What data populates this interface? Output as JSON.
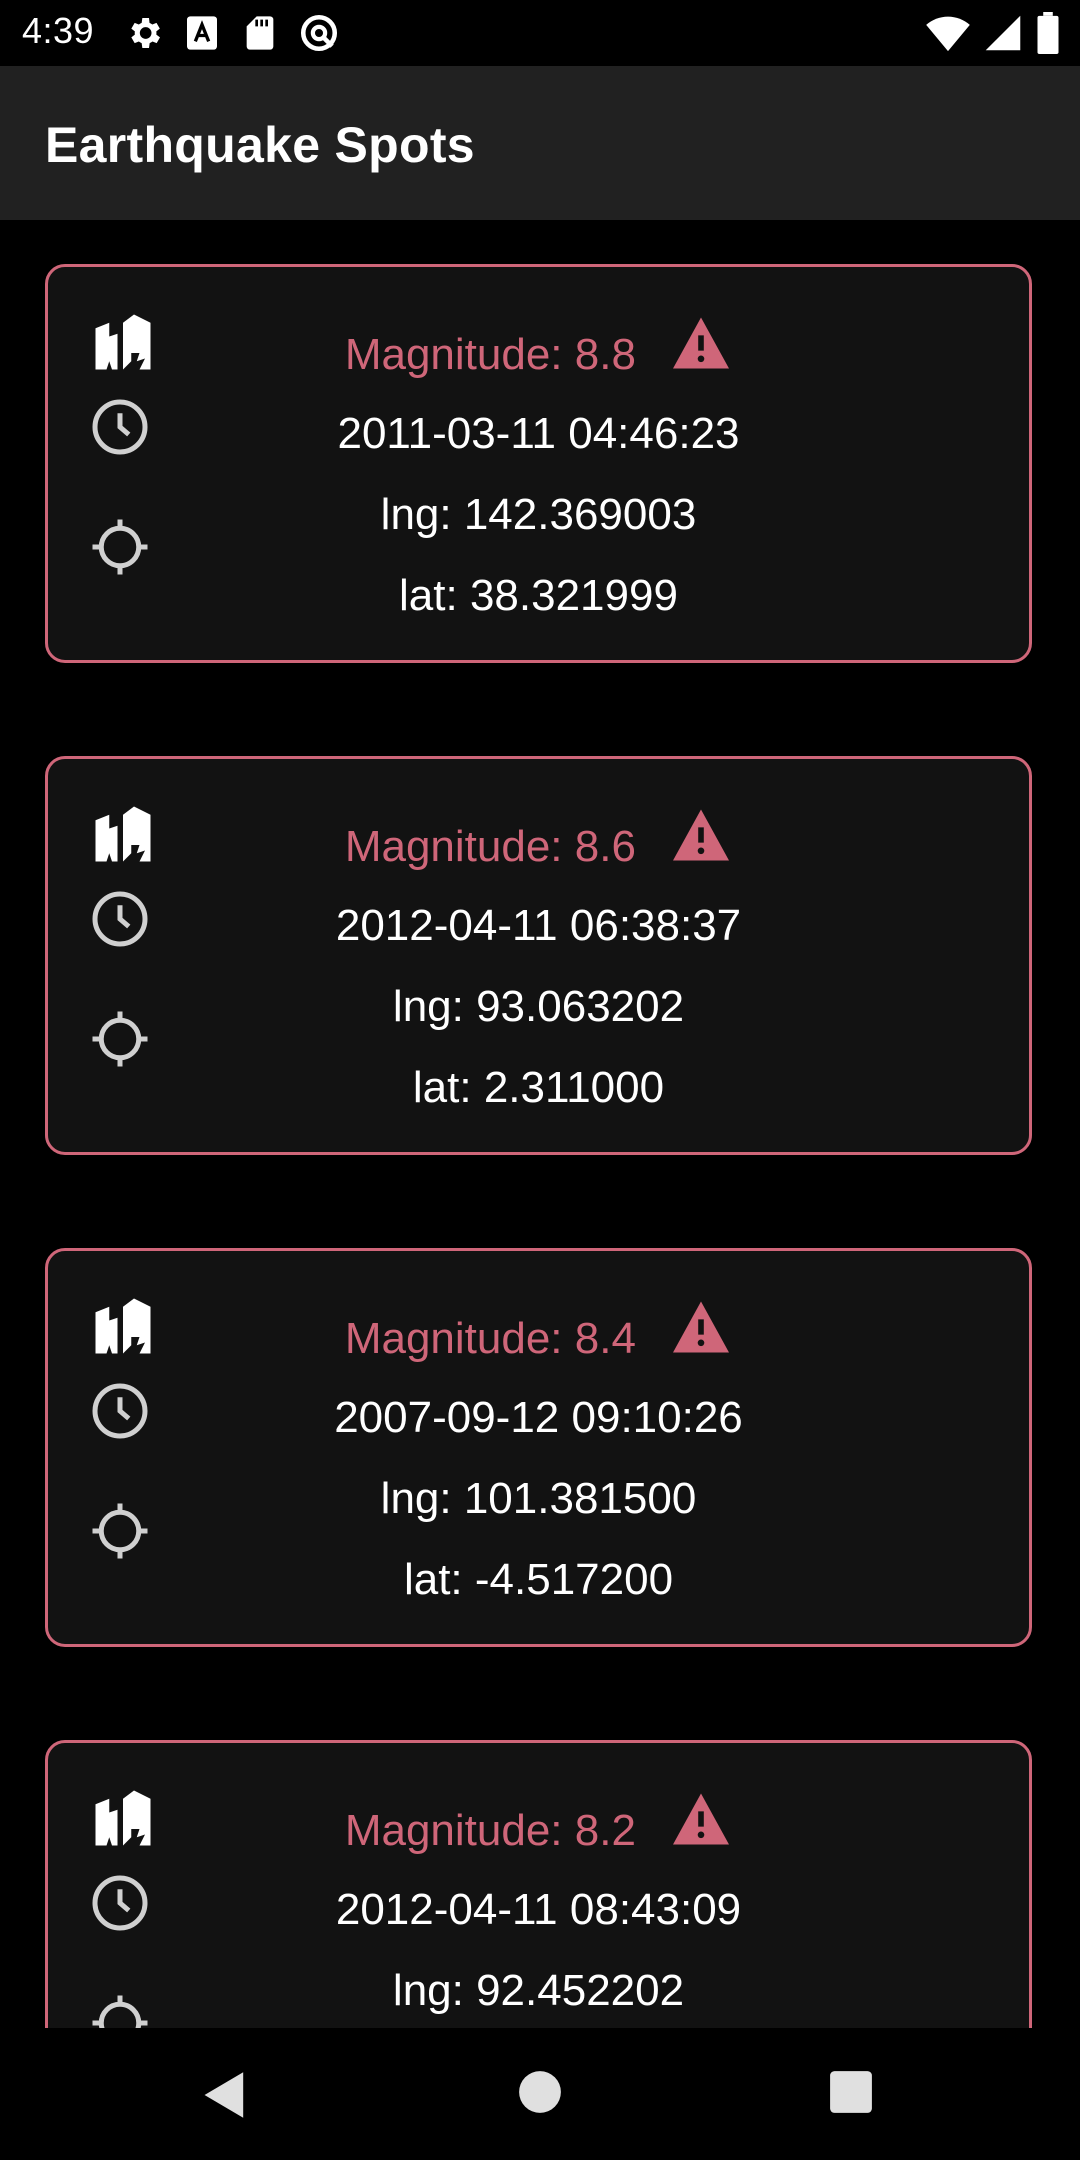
{
  "status_bar": {
    "time": "4:39",
    "left_icons": [
      "gear-icon",
      "text-a-icon",
      "sd-card-icon",
      "sync-icon"
    ],
    "right_icons": [
      "wifi-icon",
      "cell-signal-icon",
      "battery-icon"
    ]
  },
  "app_bar": {
    "title": "Earthquake Spots"
  },
  "colors": {
    "accent": "#cf6679",
    "card_bg": "#121212",
    "app_bar_bg": "#212121",
    "page_bg": "#000000"
  },
  "earthquakes": [
    {
      "magnitude": "Magnitude: 8.8",
      "time": "2011-03-11 04:46:23",
      "lng": "lng: 142.369003",
      "lat": "lat: 38.321999"
    },
    {
      "magnitude": "Magnitude: 8.6",
      "time": "2012-04-11 06:38:37",
      "lng": "lng: 93.063202",
      "lat": "lat: 2.311000"
    },
    {
      "magnitude": "Magnitude: 8.4",
      "time": "2007-09-12 09:10:26",
      "lng": "lng: 101.381500",
      "lat": "lat: -4.517200"
    },
    {
      "magnitude": "Magnitude: 8.2",
      "time": "2012-04-11 08:43:09",
      "lng": "lng: 92.452202",
      "lat": ""
    }
  ],
  "card_icons": [
    "building-collapse-icon",
    "clock-icon",
    "location-target-icon",
    "warning-icon"
  ],
  "nav_bar": [
    "back-icon",
    "home-icon",
    "recents-icon"
  ]
}
